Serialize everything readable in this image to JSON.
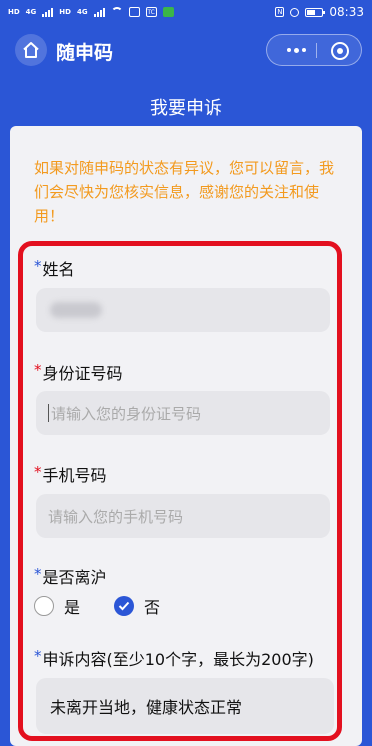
{
  "status_bar": {
    "network_a": "HD",
    "network_b": "4G",
    "network_c": "HD",
    "network_d": "4G",
    "app_badge": "TC",
    "time": "08:33",
    "battery_level": 0.55
  },
  "header": {
    "app_title": "随申码"
  },
  "page": {
    "title": "我要申诉",
    "notice": "如果对随申码的状态有异议，您可以留言，我们会尽快为您核实信息，感谢您的关注和使用！"
  },
  "form": {
    "name": {
      "star": "*",
      "label": "姓名"
    },
    "id_number": {
      "star": "*",
      "label": "身份证号码",
      "placeholder": "请输入您的身份证号码"
    },
    "phone": {
      "star": "*",
      "label": "手机号码",
      "placeholder": "请输入您的手机号码"
    },
    "left_shanghai": {
      "star": "*",
      "label": "是否离沪",
      "options": [
        {
          "label": "是",
          "selected": false
        },
        {
          "label": "否",
          "selected": true
        }
      ]
    },
    "appeal": {
      "star": "*",
      "label": "申诉内容(至少10个字，最长为200字)",
      "value": "未离开当地，健康状态正常"
    }
  },
  "colors": {
    "brand_blue": "#2b56d6",
    "notice_orange": "#f39a1e",
    "highlight_red": "#e3101f",
    "card_bg": "#f2f2f5"
  }
}
